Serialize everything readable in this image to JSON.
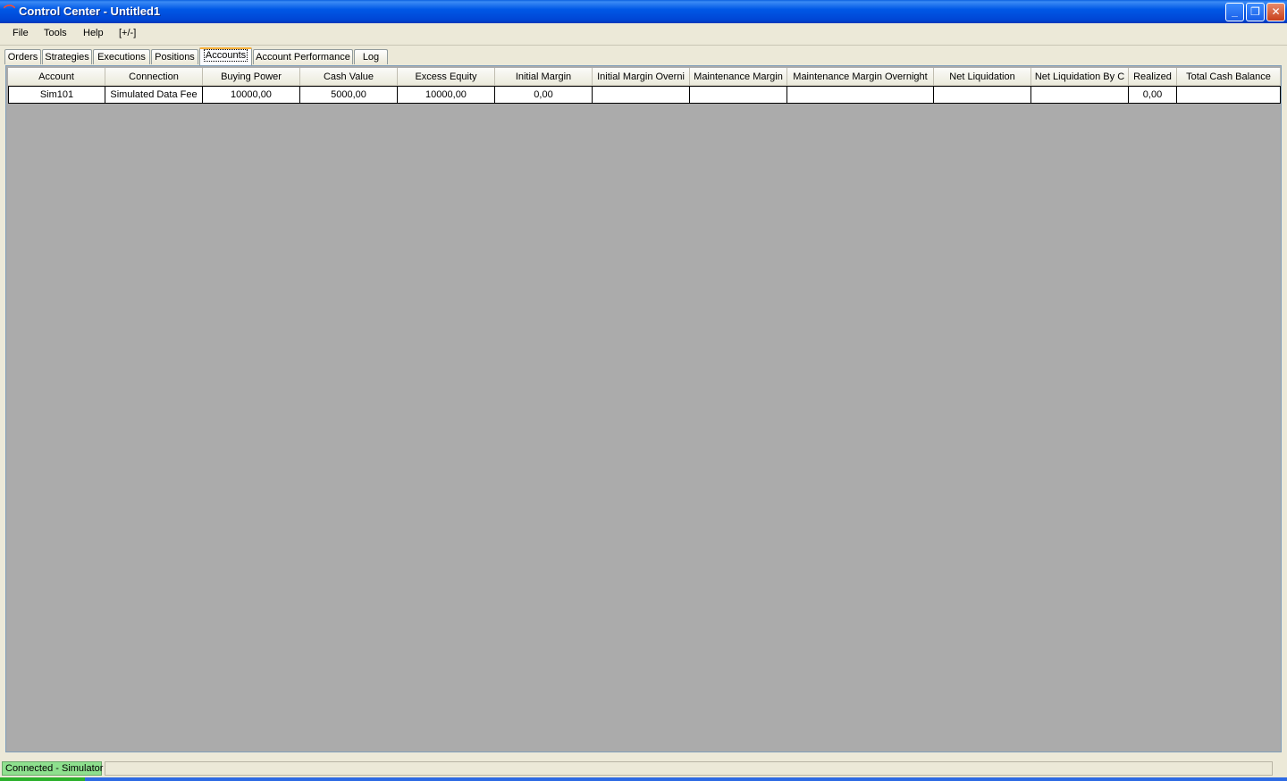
{
  "window": {
    "title": "Control Center - Untitled1",
    "minimize_glyph": "_",
    "maximize_glyph": "❐",
    "close_glyph": "✕"
  },
  "menu": [
    "File",
    "Tools",
    "Help",
    "[+/-]"
  ],
  "tabs": [
    "Orders",
    "Strategies",
    "Executions",
    "Positions",
    "Accounts",
    "Account Performance",
    "Log"
  ],
  "active_tab": "Accounts",
  "grid": {
    "columns": [
      "Account",
      "Connection",
      "Buying Power",
      "Cash Value",
      "Excess Equity",
      "Initial Margin",
      "Initial Margin Overni",
      "Maintenance Margin",
      "Maintenance Margin Overnight",
      "Net Liquidation",
      "Net Liquidation By C",
      "Realized",
      "Total Cash Balance"
    ],
    "rows": [
      [
        "Sim101",
        "Simulated Data Fee",
        "10000,00",
        "5000,00",
        "10000,00",
        "0,00",
        "",
        "",
        "",
        "",
        "",
        "0,00",
        ""
      ]
    ]
  },
  "status": {
    "connection": "Connected - Simulator"
  },
  "colors": {
    "title_bar": "#0054e3",
    "status_connected": "#8ee08e",
    "grid_background": "#ababab",
    "active_tab_accent": "#f9b03a"
  }
}
